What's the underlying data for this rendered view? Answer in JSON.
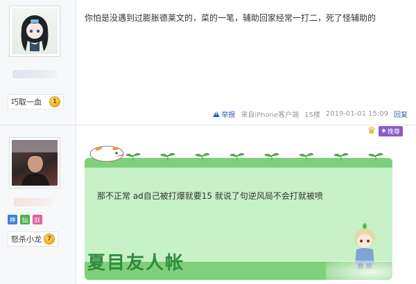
{
  "posts": [
    {
      "user": {
        "name": "",
        "badge_text": "巧取一血",
        "level": "1"
      },
      "content": "你怕是没遇到过膨胀德莱文的，菜的一笔，辅助回家经常一打二，死了怪辅助的",
      "meta": {
        "report_label": "举报",
        "source": "来自iPhone客户端",
        "floor": "15楼",
        "time": "2019-01-01 15:09",
        "reply_label": "回复"
      }
    },
    {
      "user": {
        "name": "",
        "badge_text": "怒杀小龙",
        "level": "7",
        "tags": [
          "神",
          "仙",
          "妖"
        ]
      },
      "vip_label": "挽尊",
      "content": "那不正常 ad自己被打爆就要15 就说了句逆风局不会打就被喷",
      "signature": "夏目友人帐"
    }
  ],
  "colors": {
    "bubble_bg": "#c7f1c7",
    "bubble_border": "#7fd07a",
    "link": "#2d64b3",
    "vip": "#8e59c9"
  }
}
